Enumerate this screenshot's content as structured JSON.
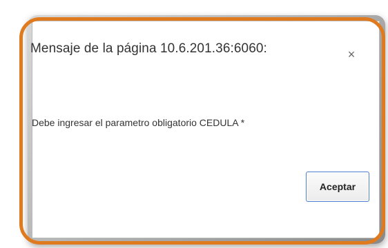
{
  "dialog": {
    "title": "Mensaje de la página 10.6.201.36:6060:",
    "close_glyph": "×",
    "close_icon": "close-icon",
    "message": "Debe ingresar el parametro obligatorio CEDULA *",
    "accept_label": "Aceptar"
  },
  "colors": {
    "highlight_ring": "#e07a1f",
    "button_focus_border": "#4a7fd4"
  }
}
